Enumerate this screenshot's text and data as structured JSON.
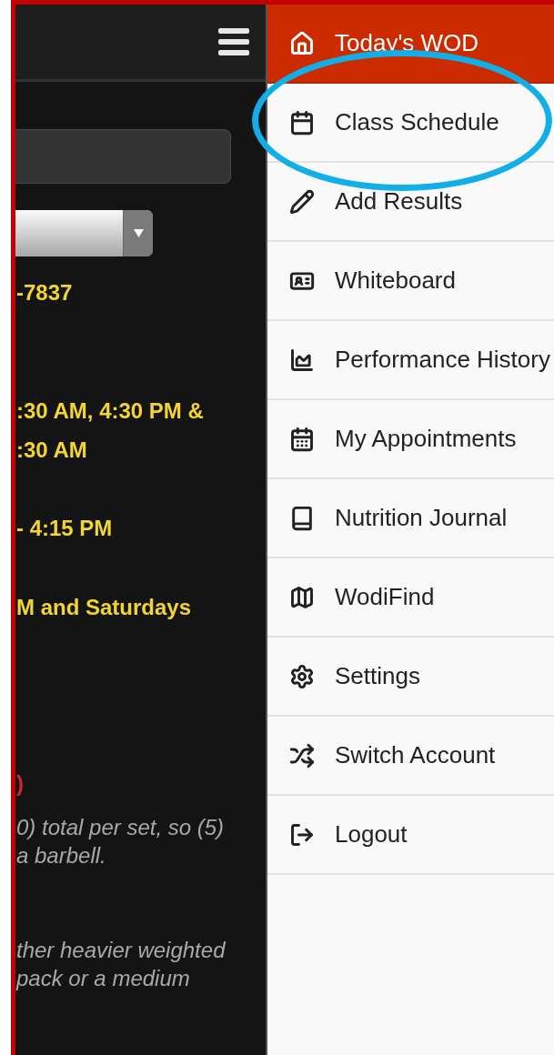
{
  "left_panel": {
    "lines": [
      {
        "text": "-7837",
        "kind": "highlight"
      },
      {
        "text": ":30 AM, 4:30 PM &",
        "kind": "highlight"
      },
      {
        "text": ":30 AM",
        "kind": "highlight"
      },
      {
        "text": "- 4:15 PM",
        "kind": "highlight"
      },
      {
        "text": "M and Saturdays",
        "kind": "highlight"
      },
      {
        "text": ")",
        "kind": "alert"
      },
      {
        "text": "0) total per set, so (5)",
        "kind": "note"
      },
      {
        "text": "a barbell.",
        "kind": "note"
      },
      {
        "text": "ther heavier weighted",
        "kind": "note"
      },
      {
        "text": "pack or a medium",
        "kind": "note"
      }
    ]
  },
  "menu": {
    "items": [
      {
        "label": "Today's WOD",
        "selected": true,
        "highlighted": false
      },
      {
        "label": "Class Schedule",
        "selected": false,
        "highlighted": true
      },
      {
        "label": "Add Results",
        "selected": false,
        "highlighted": false
      },
      {
        "label": "Whiteboard",
        "selected": false,
        "highlighted": false
      },
      {
        "label": "Performance History",
        "selected": false,
        "highlighted": false
      },
      {
        "label": "My Appointments",
        "selected": false,
        "highlighted": false
      },
      {
        "label": "Nutrition Journal",
        "selected": false,
        "highlighted": false
      },
      {
        "label": "WodiFind",
        "selected": false,
        "highlighted": false
      },
      {
        "label": "Settings",
        "selected": false,
        "highlighted": false
      },
      {
        "label": "Switch Account",
        "selected": false,
        "highlighted": false
      },
      {
        "label": "Logout",
        "selected": false,
        "highlighted": false
      }
    ]
  }
}
